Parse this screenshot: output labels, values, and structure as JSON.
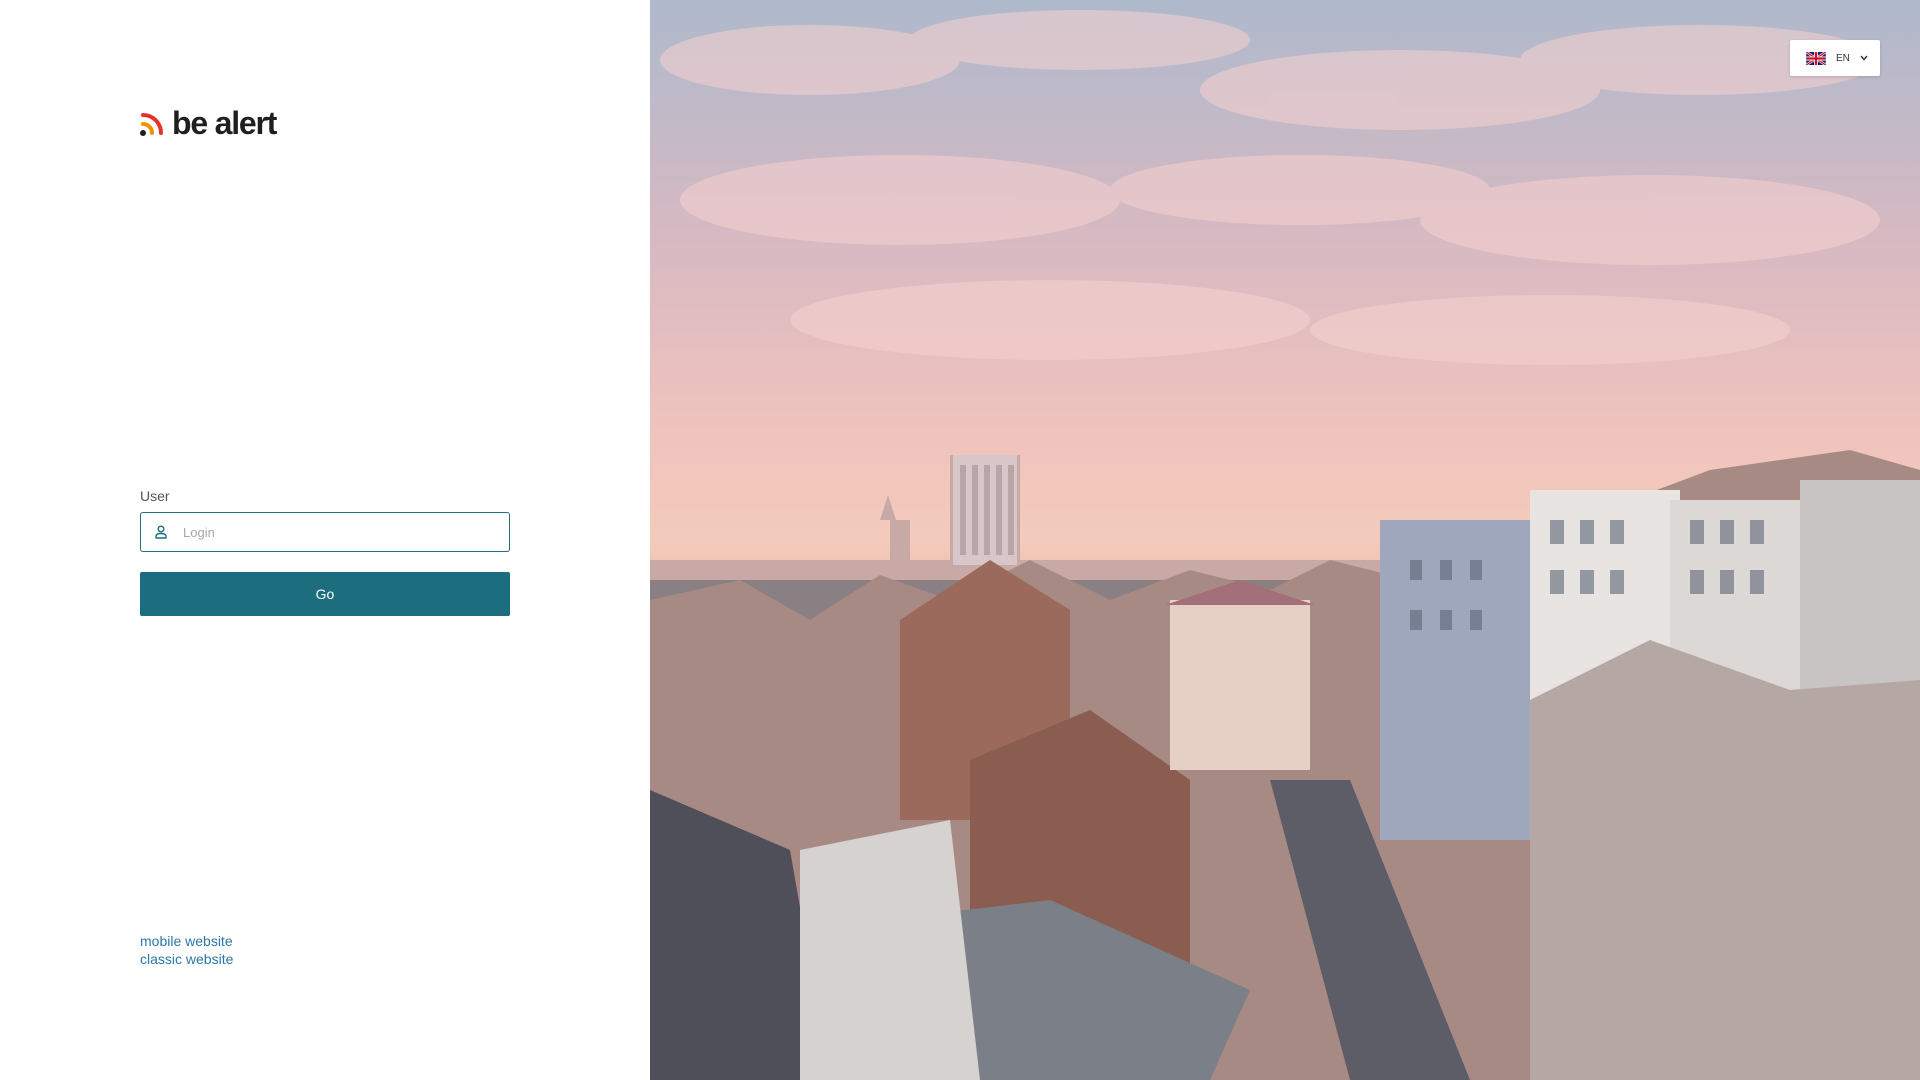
{
  "logo": {
    "text": "be alert",
    "icon": "signal-wave-icon",
    "colors": [
      "#f39200",
      "#e6332a",
      "#1f1f1f"
    ]
  },
  "login_form": {
    "user_label": "User",
    "user_placeholder": "Login",
    "user_icon": "user-icon",
    "submit_label": "Go",
    "accent_color": "#1c6e7f"
  },
  "footer_links": {
    "mobile": "mobile website",
    "classic": "classic website"
  },
  "language": {
    "code": "EN",
    "flag_icon": "uk-flag-icon",
    "chevron_icon": "chevron-down-icon"
  },
  "hero_image": {
    "subject": "city-rooftops-photo"
  }
}
